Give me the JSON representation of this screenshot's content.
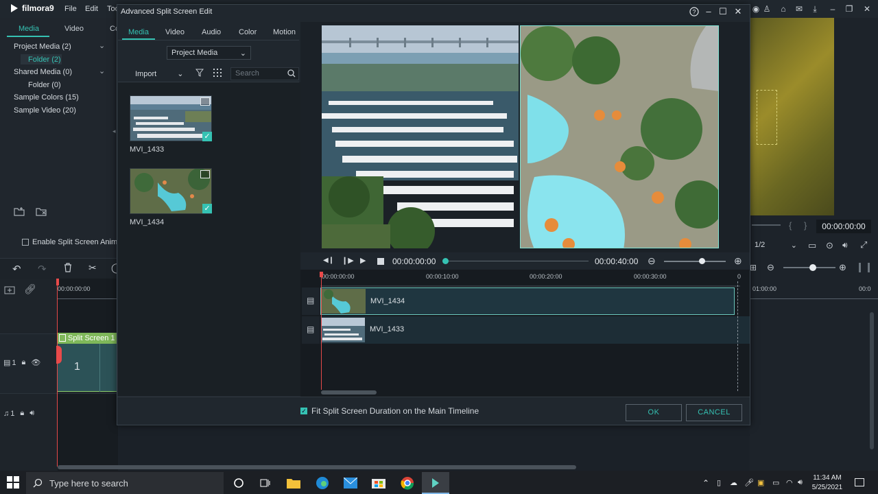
{
  "app": {
    "name": "filmora9",
    "menu": [
      "File",
      "Edit",
      "Too"
    ]
  },
  "left_panel": {
    "tabs": [
      "Media",
      "Video",
      "Co"
    ],
    "tree": [
      {
        "label": "Project Media (2)"
      },
      {
        "label": "Folder (2)"
      },
      {
        "label": "Shared Media (0)"
      },
      {
        "label": "Folder (0)"
      },
      {
        "label": "Sample Colors (15)"
      },
      {
        "label": "Sample Video (20)"
      }
    ],
    "enable_split_label": "Enable Split Screen Anim"
  },
  "main_timeline": {
    "timecode": "00:00:00:00",
    "clip_label": "Split Screen 1",
    "clip_number": "1",
    "video_track_num": "1",
    "audio_track_num": "1"
  },
  "right_panel": {
    "timecode": "00:00:00:00",
    "page": "1/2",
    "ruler_time": "01:00:00",
    "ruler_time2": "00:0"
  },
  "dialog": {
    "title": "Advanced Split Screen Edit",
    "tabs": [
      "Media",
      "Video",
      "Audio",
      "Color",
      "Motion"
    ],
    "media_source": "Project Media",
    "import_label": "Import",
    "search_placeholder": "Search",
    "media": [
      {
        "name": "MVI_1433"
      },
      {
        "name": "MVI_1434"
      }
    ],
    "controls": {
      "current_time": "00:00:00:00",
      "total_time": "00:00:40:00"
    },
    "ruler": [
      "00:00:00:00",
      "00:00:10:00",
      "00:00:20:00",
      "00:00:30:00",
      "0"
    ],
    "tracks": [
      {
        "name": "MVI_1434"
      },
      {
        "name": "MVI_1433"
      }
    ],
    "fit_label": "Fit Split Screen Duration on the Main Timeline",
    "ok_label": "OK",
    "cancel_label": "CANCEL"
  },
  "taskbar": {
    "search_placeholder": "Type here to search",
    "time": "11:34 AM",
    "date": "5/25/2021"
  },
  "colors": {
    "accent": "#35c2b3",
    "playhead": "#e84a4a",
    "clip_green": "#7fb85a"
  }
}
